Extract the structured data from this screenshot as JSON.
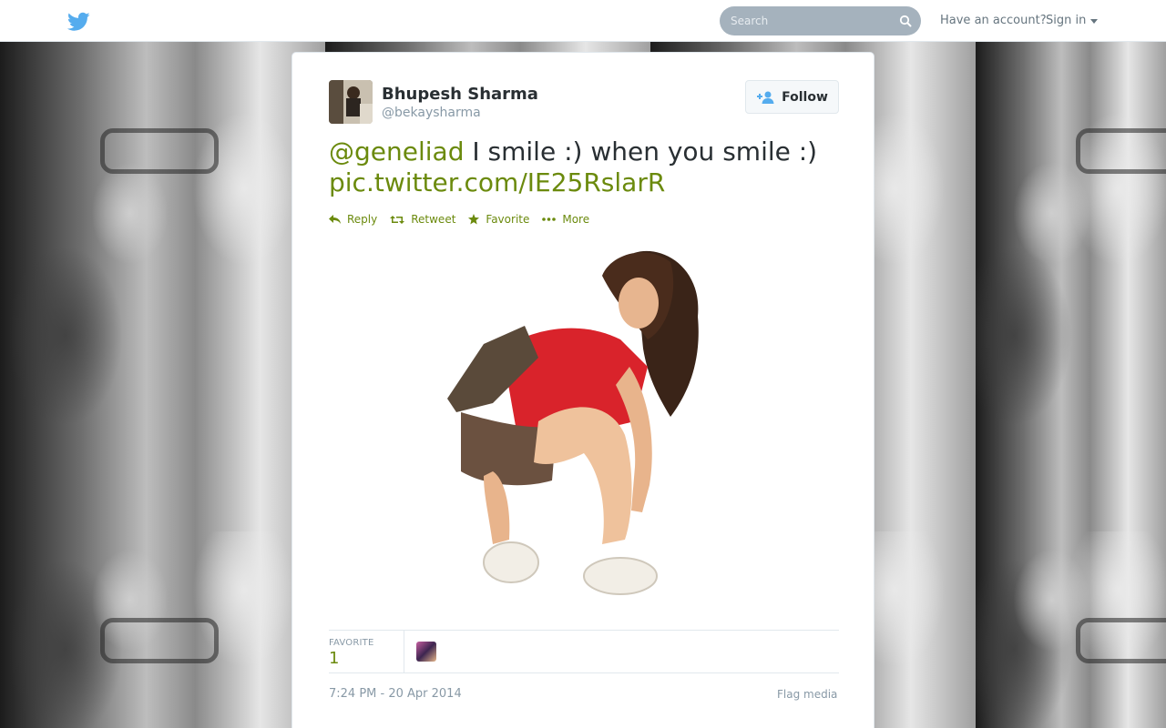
{
  "topbar": {
    "search_placeholder": "Search",
    "account_prompt": "Have an account?",
    "signin_label": "Sign in"
  },
  "tweet": {
    "author_name": "Bhupesh Sharma",
    "author_handle": "@bekaysharma",
    "follow_label": "Follow",
    "mention": "@geneliad",
    "text": " I smile :) when you smile :) ",
    "pic_link": "pic.twitter.com/IE25RslarR",
    "actions": {
      "reply": "Reply",
      "retweet": "Retweet",
      "favorite": "Favorite",
      "more": "More"
    },
    "stats": {
      "favorite_label": "FAVORITE",
      "favorite_count": "1"
    },
    "timestamp": "7:24 PM - 20 Apr 2014",
    "flag_label": "Flag media"
  },
  "colors": {
    "link": "#6b8a0d",
    "twitter_blue": "#55acee"
  }
}
